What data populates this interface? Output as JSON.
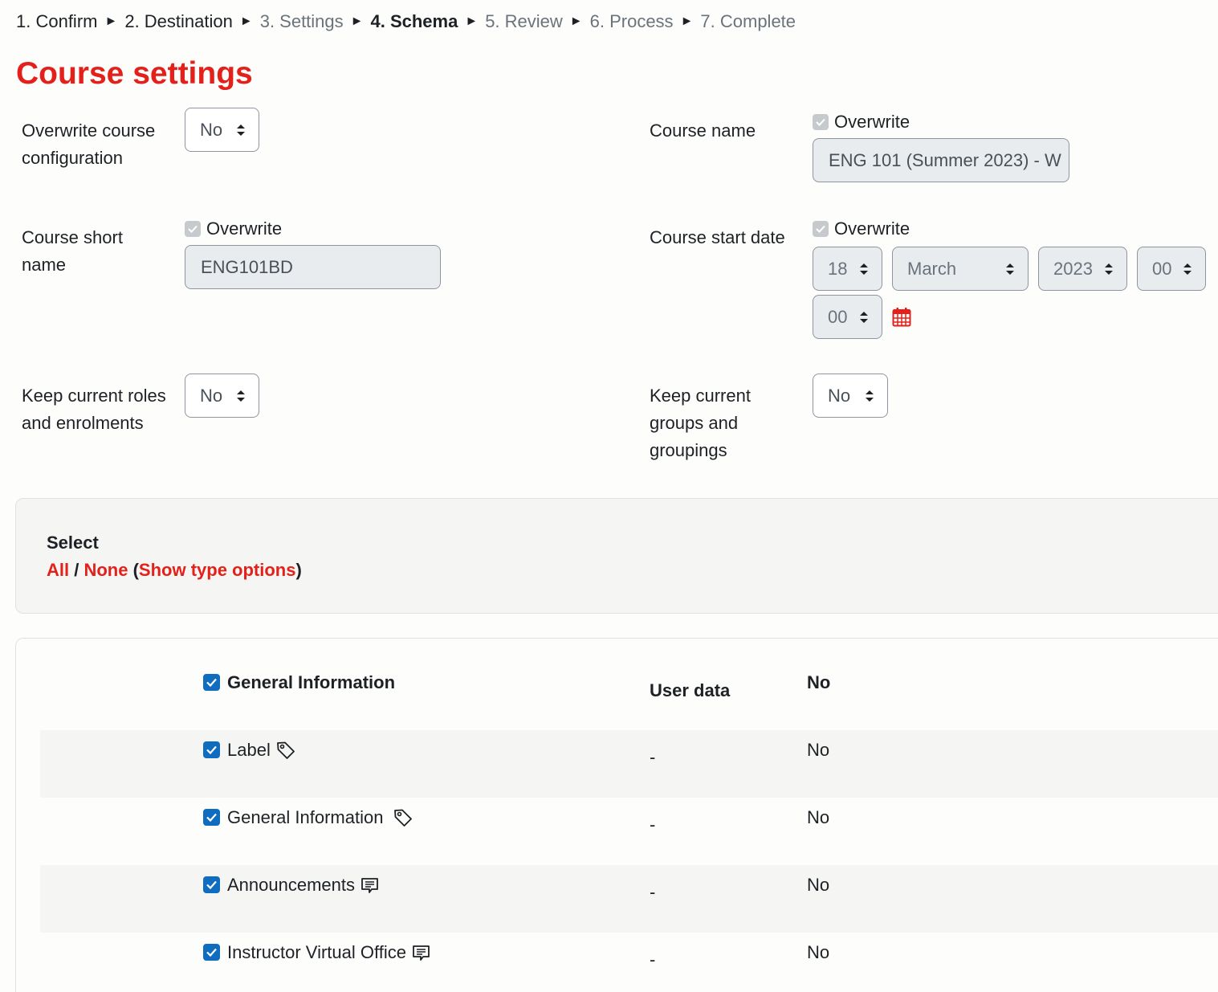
{
  "breadcrumb": {
    "steps": [
      {
        "label": "1. Confirm",
        "state": "done"
      },
      {
        "label": "2. Destination",
        "state": "done"
      },
      {
        "label": "3. Settings",
        "state": "future"
      },
      {
        "label": "4. Schema",
        "state": "current"
      },
      {
        "label": "5. Review",
        "state": "future"
      },
      {
        "label": "6. Process",
        "state": "future"
      },
      {
        "label": "7. Complete",
        "state": "future"
      }
    ],
    "separator": "►"
  },
  "page_title": "Course settings",
  "settings": {
    "overwrite_config": {
      "label_line1": "Overwrite course",
      "label_line2": "configuration",
      "value": "No"
    },
    "course_name": {
      "label": "Course name",
      "overwrite_label": "Overwrite",
      "value": "ENG 101 (Summer 2023) - W"
    },
    "short_name": {
      "label_line1": "Course short",
      "label_line2": "name",
      "overwrite_label": "Overwrite",
      "value": "ENG101BD"
    },
    "start_date": {
      "label": "Course start date",
      "overwrite_label": "Overwrite",
      "day": "18",
      "month": "March",
      "year": "2023",
      "hour": "00",
      "minute": "00"
    },
    "keep_roles": {
      "label_line1": "Keep current roles",
      "label_line2": "and enrolments",
      "value": "No"
    },
    "keep_groups": {
      "label_line1": "Keep current",
      "label_line2": "groups and",
      "label_line3": "groupings",
      "value": "No"
    }
  },
  "select_panel": {
    "heading": "Select",
    "all": "All",
    "slash": " / ",
    "none": "None",
    "open_paren": " (",
    "show_type_options": "Show type options",
    "close_paren": ")"
  },
  "items": {
    "section_title": "General Information",
    "user_data_header": "User data",
    "section_value": "No",
    "rows": [
      {
        "name": "Label",
        "icon": "tag-icon",
        "user_data": "-",
        "value": "No"
      },
      {
        "name": "General Information",
        "icon": "tag-icon",
        "user_data": "-",
        "value": "No"
      },
      {
        "name": "Announcements",
        "icon": "forum-icon",
        "user_data": "-",
        "value": "No"
      },
      {
        "name": "Instructor Virtual Office",
        "icon": "forum-icon",
        "user_data": "-",
        "value": "No"
      }
    ]
  },
  "colors": {
    "accent": "#e3201a",
    "checkbox": "#0f6cbf",
    "disabled_bg": "#e9ecef"
  }
}
